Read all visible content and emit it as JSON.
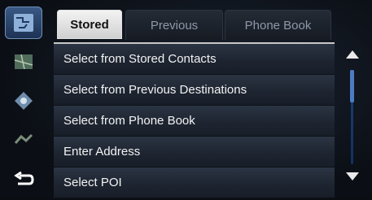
{
  "tabs": [
    {
      "label": "Stored",
      "active": true
    },
    {
      "label": "Previous",
      "active": false
    },
    {
      "label": "Phone Book",
      "active": false
    }
  ],
  "list": {
    "items": [
      {
        "label": "Select from Stored Contacts"
      },
      {
        "label": "Select from Previous Destinations"
      },
      {
        "label": "Select from Phone Book"
      },
      {
        "label": "Enter Address"
      },
      {
        "label": "Select POI"
      }
    ]
  },
  "rail": {
    "items": [
      {
        "icon": "destination-icon",
        "active": true
      },
      {
        "icon": "map-pin-icon",
        "active": false
      },
      {
        "icon": "compass-icon",
        "active": false
      },
      {
        "icon": "route-icon",
        "active": false
      },
      {
        "icon": "back-arrow-icon",
        "active": false
      }
    ]
  },
  "colors": {
    "accent": "#4c7cc4",
    "active_tab_bg": "#e6e6e6",
    "row_bg": "#1d2430",
    "text": "#f2f2f2"
  }
}
